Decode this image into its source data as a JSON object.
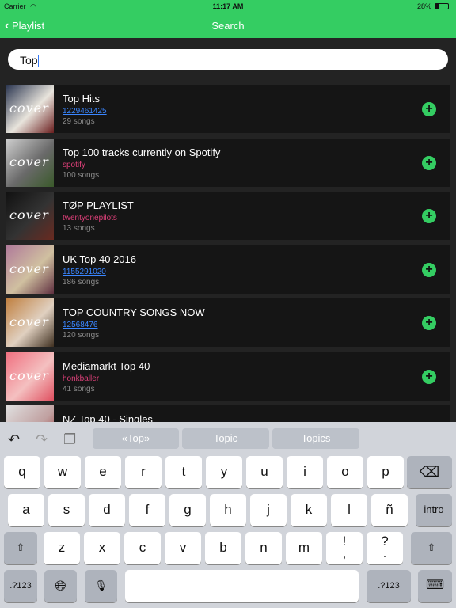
{
  "status": {
    "carrier": "Carrier",
    "time": "11:17 AM",
    "battery": "28%"
  },
  "nav": {
    "back_label": "Playlist",
    "title": "Search"
  },
  "search": {
    "value": "Top"
  },
  "results": [
    {
      "title": "Top Hits",
      "owner": "1229461425",
      "owner_type": "link",
      "count": "29 songs",
      "cover": [
        "#2a3550",
        "#e8e4dc",
        "#6b1e1e"
      ]
    },
    {
      "title": "Top 100 tracks currently on Spotify",
      "owner": "spotify",
      "owner_type": "user",
      "count": "100 songs",
      "cover": [
        "#cfcfcf",
        "#6a6a6a",
        "#3a5a2a"
      ]
    },
    {
      "title": "TØP PLAYLIST",
      "owner": "twentyonepilots",
      "owner_type": "user",
      "count": "13 songs",
      "cover": [
        "#111111",
        "#333333",
        "#6a2a20"
      ]
    },
    {
      "title": "UK Top 40 2016",
      "owner": "1155291020",
      "owner_type": "link",
      "count": "186 songs",
      "cover": [
        "#b07a9a",
        "#d0c0a0",
        "#603040"
      ]
    },
    {
      "title": "TOP COUNTRY SONGS NOW",
      "owner": "12568476",
      "owner_type": "link",
      "count": "120 songs",
      "cover": [
        "#c08040",
        "#e0d0c0",
        "#403020"
      ]
    },
    {
      "title": "Mediamarkt Top 40",
      "owner": "honkballer",
      "owner_type": "user",
      "count": "41 songs",
      "cover": [
        "#f07080",
        "#f4c0c0",
        "#e05060"
      ]
    },
    {
      "title": "NZ Top 40 - Singles",
      "owner": "",
      "owner_type": "user",
      "count": "",
      "cover": [
        "#e0e0e0",
        "#c0a0a0",
        "#902020"
      ]
    }
  ],
  "cover_label": "cover",
  "keyboard": {
    "suggestions": [
      "«Top»",
      "Topic",
      "Topics"
    ],
    "row1": [
      "q",
      "w",
      "e",
      "r",
      "t",
      "y",
      "u",
      "i",
      "o",
      "p"
    ],
    "row2": [
      "a",
      "s",
      "d",
      "f",
      "g",
      "h",
      "j",
      "k",
      "l",
      "ñ"
    ],
    "row3": [
      "z",
      "x",
      "c",
      "v",
      "b",
      "n",
      "m",
      "!\n,",
      "?\n."
    ],
    "return_label": "intro",
    "numbers_label": ".?123"
  },
  "colors": {
    "accent": "#34cd62",
    "link": "#3a86ff",
    "user": "#e0407a"
  }
}
